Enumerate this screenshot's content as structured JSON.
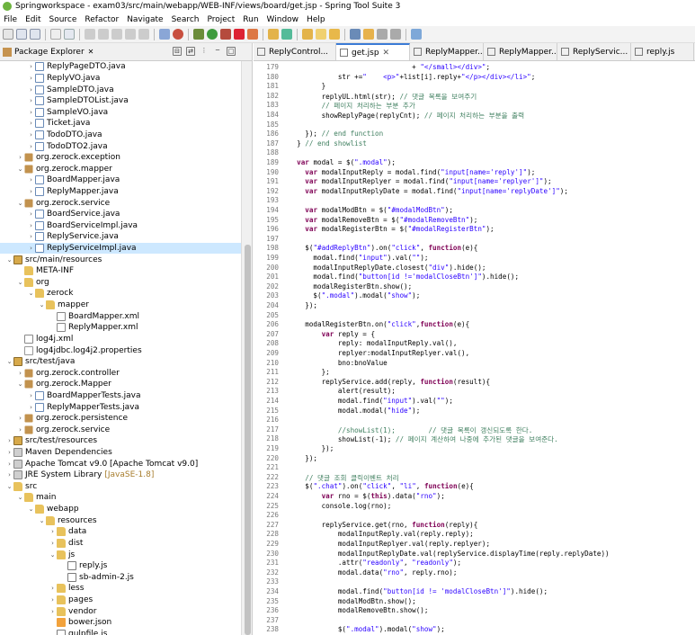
{
  "window": {
    "title": "Springworkspace - exam03/src/main/webapp/WEB-INF/views/board/get.jsp - Spring Tool Suite 3"
  },
  "menu": [
    "File",
    "Edit",
    "Source",
    "Refactor",
    "Navigate",
    "Search",
    "Project",
    "Run",
    "Window",
    "Help"
  ],
  "left_view": {
    "title": "Package Explorer",
    "close": "✕"
  },
  "tree": [
    {
      "d": 2,
      "ic": "java",
      "t": "ReplyPageDTO.java",
      "a": ">"
    },
    {
      "d": 2,
      "ic": "java",
      "t": "ReplyVO.java",
      "a": ">"
    },
    {
      "d": 2,
      "ic": "java",
      "t": "SampleDTO.java",
      "a": ">"
    },
    {
      "d": 2,
      "ic": "java",
      "t": "SampleDTOList.java",
      "a": ">"
    },
    {
      "d": 2,
      "ic": "java",
      "t": "SampleVO.java",
      "a": ">"
    },
    {
      "d": 2,
      "ic": "java",
      "t": "Ticket.java",
      "a": ">"
    },
    {
      "d": 2,
      "ic": "java",
      "t": "TodoDTO.java",
      "a": ">"
    },
    {
      "d": 2,
      "ic": "java",
      "t": "TodoDTO2.java",
      "a": ">"
    },
    {
      "d": 1,
      "ic": "pkg",
      "t": "org.zerock.exception",
      "a": ">"
    },
    {
      "d": 1,
      "ic": "pkg",
      "t": "org.zerock.mapper",
      "a": "v"
    },
    {
      "d": 2,
      "ic": "java",
      "t": "BoardMapper.java",
      "a": ">"
    },
    {
      "d": 2,
      "ic": "java",
      "t": "ReplyMapper.java",
      "a": ">"
    },
    {
      "d": 1,
      "ic": "pkg",
      "t": "org.zerock.service",
      "a": "v"
    },
    {
      "d": 2,
      "ic": "java",
      "t": "BoardService.java",
      "a": ">"
    },
    {
      "d": 2,
      "ic": "java",
      "t": "BoardServiceImpl.java",
      "a": ">"
    },
    {
      "d": 2,
      "ic": "java",
      "t": "ReplyService.java",
      "a": ">"
    },
    {
      "d": 2,
      "ic": "java",
      "t": "ReplyServiceImpl.java",
      "a": ">",
      "sel": true
    },
    {
      "d": 0,
      "ic": "srcf",
      "t": "src/main/resources",
      "a": "v"
    },
    {
      "d": 1,
      "ic": "fold",
      "t": "META-INF",
      "a": ""
    },
    {
      "d": 1,
      "ic": "fold",
      "t": "org",
      "a": "v"
    },
    {
      "d": 2,
      "ic": "fold",
      "t": "zerock",
      "a": "v"
    },
    {
      "d": 3,
      "ic": "fold",
      "t": "mapper",
      "a": "v"
    },
    {
      "d": 4,
      "ic": "xml",
      "t": "BoardMapper.xml",
      "a": ""
    },
    {
      "d": 4,
      "ic": "xml",
      "t": "ReplyMapper.xml",
      "a": ""
    },
    {
      "d": 1,
      "ic": "xml",
      "t": "log4j.xml",
      "a": ""
    },
    {
      "d": 1,
      "ic": "prop",
      "t": "log4jdbc.log4j2.properties",
      "a": ""
    },
    {
      "d": 0,
      "ic": "srcf",
      "t": "src/test/java",
      "a": "v"
    },
    {
      "d": 1,
      "ic": "pkg",
      "t": "org.zerock.controller",
      "a": ">"
    },
    {
      "d": 1,
      "ic": "pkg",
      "t": "org.zerock.Mapper",
      "a": "v"
    },
    {
      "d": 2,
      "ic": "java",
      "t": "BoardMapperTests.java",
      "a": ">"
    },
    {
      "d": 2,
      "ic": "java",
      "t": "ReplyMapperTests.java",
      "a": ">"
    },
    {
      "d": 1,
      "ic": "pkg",
      "t": "org.zerock.persistence",
      "a": ">"
    },
    {
      "d": 1,
      "ic": "pkg",
      "t": "org.zerock.service",
      "a": ">"
    },
    {
      "d": 0,
      "ic": "srcf",
      "t": "src/test/resources",
      "a": ">"
    },
    {
      "d": 0,
      "ic": "lib",
      "t": "Maven Dependencies",
      "a": ">"
    },
    {
      "d": 0,
      "ic": "lib",
      "t": "Apache Tomcat v9.0 [Apache Tomcat v9.0]",
      "a": ">"
    },
    {
      "d": 0,
      "ic": "lib",
      "t": "JRE System Library",
      "sub": "[JavaSE-1.8]",
      "a": ">"
    },
    {
      "d": 0,
      "ic": "fold",
      "t": "src",
      "a": "v"
    },
    {
      "d": 1,
      "ic": "fold",
      "t": "main",
      "a": "v"
    },
    {
      "d": 2,
      "ic": "fold",
      "t": "webapp",
      "a": "v"
    },
    {
      "d": 3,
      "ic": "fold",
      "t": "resources",
      "a": "v"
    },
    {
      "d": 4,
      "ic": "fold",
      "t": "data",
      "a": ">"
    },
    {
      "d": 4,
      "ic": "fold",
      "t": "dist",
      "a": ">"
    },
    {
      "d": 4,
      "ic": "fold",
      "t": "js",
      "a": "v"
    },
    {
      "d": 5,
      "ic": "js",
      "t": "reply.js",
      "a": ""
    },
    {
      "d": 5,
      "ic": "js",
      "t": "sb-admin-2.js",
      "a": ""
    },
    {
      "d": 4,
      "ic": "fold",
      "t": "less",
      "a": ">"
    },
    {
      "d": 4,
      "ic": "fold",
      "t": "pages",
      "a": ">"
    },
    {
      "d": 4,
      "ic": "fold",
      "t": "vendor",
      "a": ">"
    },
    {
      "d": 4,
      "ic": "json",
      "t": "bower.json",
      "a": ""
    },
    {
      "d": 4,
      "ic": "js",
      "t": "gulpfile.js",
      "a": ""
    }
  ],
  "editor_tabs": [
    {
      "label": "ReplyControl...",
      "active": false
    },
    {
      "label": "get.jsp",
      "active": true,
      "close": "✕"
    },
    {
      "label": "ReplyMapper....",
      "active": false
    },
    {
      "label": "ReplyMapper....",
      "active": false
    },
    {
      "label": "ReplyServic...",
      "active": false
    },
    {
      "label": "reply.js",
      "active": false
    }
  ],
  "code": [
    {
      "n": "179",
      "t": "                              + \"</small></div>\";"
    },
    {
      "n": "180",
      "t": "            str +=\"    <p>\"+list[i].reply+\"</p></div></li>\";"
    },
    {
      "n": "181",
      "t": "        }"
    },
    {
      "n": "182",
      "t": "        replyUL.html(str); // 댓글 목록을 보여주기"
    },
    {
      "n": "183",
      "t": "        // 페이지 처리하는 부분 추가"
    },
    {
      "n": "184",
      "t": "        showReplyPage(replyCnt); // 페이지 처리하는 부분을 출력"
    },
    {
      "n": "185",
      "t": ""
    },
    {
      "n": "186",
      "t": "    }); // end function"
    },
    {
      "n": "187",
      "t": "  } // end showlist"
    },
    {
      "n": "188",
      "t": ""
    },
    {
      "n": "189",
      "t": "  var modal = $(\".modal\");"
    },
    {
      "n": "190",
      "t": "    var modalInputReply = modal.find(\"input[name='reply']\");"
    },
    {
      "n": "191",
      "t": "    var modalInputReplyer = modal.find(\"input[name='replyer']\");"
    },
    {
      "n": "192",
      "t": "    var modalInputReplyDate = modal.find(\"input[name='replyDate']\");"
    },
    {
      "n": "193",
      "t": ""
    },
    {
      "n": "194",
      "t": "    var modalModBtn = $(\"#modalModBtn\");"
    },
    {
      "n": "195",
      "t": "    var modalRemoveBtn = $(\"#modalRemoveBtn\");"
    },
    {
      "n": "196",
      "t": "    var modalRegisterBtn = $(\"#modalRegisterBtn\");"
    },
    {
      "n": "197",
      "t": ""
    },
    {
      "n": "198",
      "t": "    $(\"#addReplyBtn\").on(\"click\", function(e){"
    },
    {
      "n": "199",
      "t": "      modal.find(\"input\").val(\"\");"
    },
    {
      "n": "200",
      "t": "      modalInputReplyDate.closest(\"div\").hide();"
    },
    {
      "n": "201",
      "t": "      modal.find(\"button[id !='modalCloseBtn']\").hide();"
    },
    {
      "n": "202",
      "t": "      modalRegisterBtn.show();"
    },
    {
      "n": "203",
      "t": "      $(\".modal\").modal(\"show\");"
    },
    {
      "n": "204",
      "t": "    });"
    },
    {
      "n": "205",
      "t": ""
    },
    {
      "n": "206",
      "t": "    modalRegisterBtn.on(\"click\",function(e){"
    },
    {
      "n": "207",
      "t": "        var reply = {"
    },
    {
      "n": "208",
      "t": "            reply: modalInputReply.val(),"
    },
    {
      "n": "209",
      "t": "            replyer:modalInputReplyer.val(),"
    },
    {
      "n": "210",
      "t": "            bno:bnoValue"
    },
    {
      "n": "211",
      "t": "        };"
    },
    {
      "n": "212",
      "t": "        replyService.add(reply, function(result){"
    },
    {
      "n": "213",
      "t": "            alert(result);"
    },
    {
      "n": "214",
      "t": "            modal.find(\"input\").val(\"\");"
    },
    {
      "n": "215",
      "t": "            modal.modal(\"hide\");"
    },
    {
      "n": "216",
      "t": ""
    },
    {
      "n": "217",
      "t": "            //showList(1);        // 댓글 목록이 갱신되도록 한다."
    },
    {
      "n": "218",
      "t": "            showList(-1); // 페이지 계산하여 나중에 추가된 댓글을 보여준다."
    },
    {
      "n": "219",
      "t": "        });"
    },
    {
      "n": "220",
      "t": "    });"
    },
    {
      "n": "221",
      "t": ""
    },
    {
      "n": "222",
      "t": "    // 댓글 조회 클릭이벤트 처리"
    },
    {
      "n": "223",
      "t": "    $(\".chat\").on(\"click\", \"li\", function(e){"
    },
    {
      "n": "224",
      "t": "        var rno = $(this).data(\"rno\");"
    },
    {
      "n": "225",
      "t": "        console.log(rno);"
    },
    {
      "n": "226",
      "t": ""
    },
    {
      "n": "227",
      "t": "        replyService.get(rno, function(reply){"
    },
    {
      "n": "228",
      "t": "            modalInputReply.val(reply.reply);"
    },
    {
      "n": "229",
      "t": "            modalInputReplyer.val(reply.replyer);"
    },
    {
      "n": "230",
      "t": "            modalInputReplyDate.val(replyService.displayTime(reply.replyDate))"
    },
    {
      "n": "231",
      "t": "            .attr(\"readonly\", \"readonly\");"
    },
    {
      "n": "232",
      "t": "            modal.data(\"rno\", reply.rno);"
    },
    {
      "n": "233",
      "t": ""
    },
    {
      "n": "234",
      "t": "            modal.find(\"button[id != 'modalCloseBtn']\").hide();"
    },
    {
      "n": "235",
      "t": "            modalModBtn.show();"
    },
    {
      "n": "236",
      "t": "            modalRemoveBtn.show();"
    },
    {
      "n": "237",
      "t": ""
    },
    {
      "n": "238",
      "t": "            $(\".modal\").modal(\"show\");"
    },
    {
      "n": "239",
      "t": "        });"
    }
  ],
  "colors": {
    "keyword": "#7f0055",
    "string": "#2a00ff",
    "comment": "#3f7f5f",
    "selection": "#cde8ff",
    "active_tab": "#3b7bd6"
  }
}
